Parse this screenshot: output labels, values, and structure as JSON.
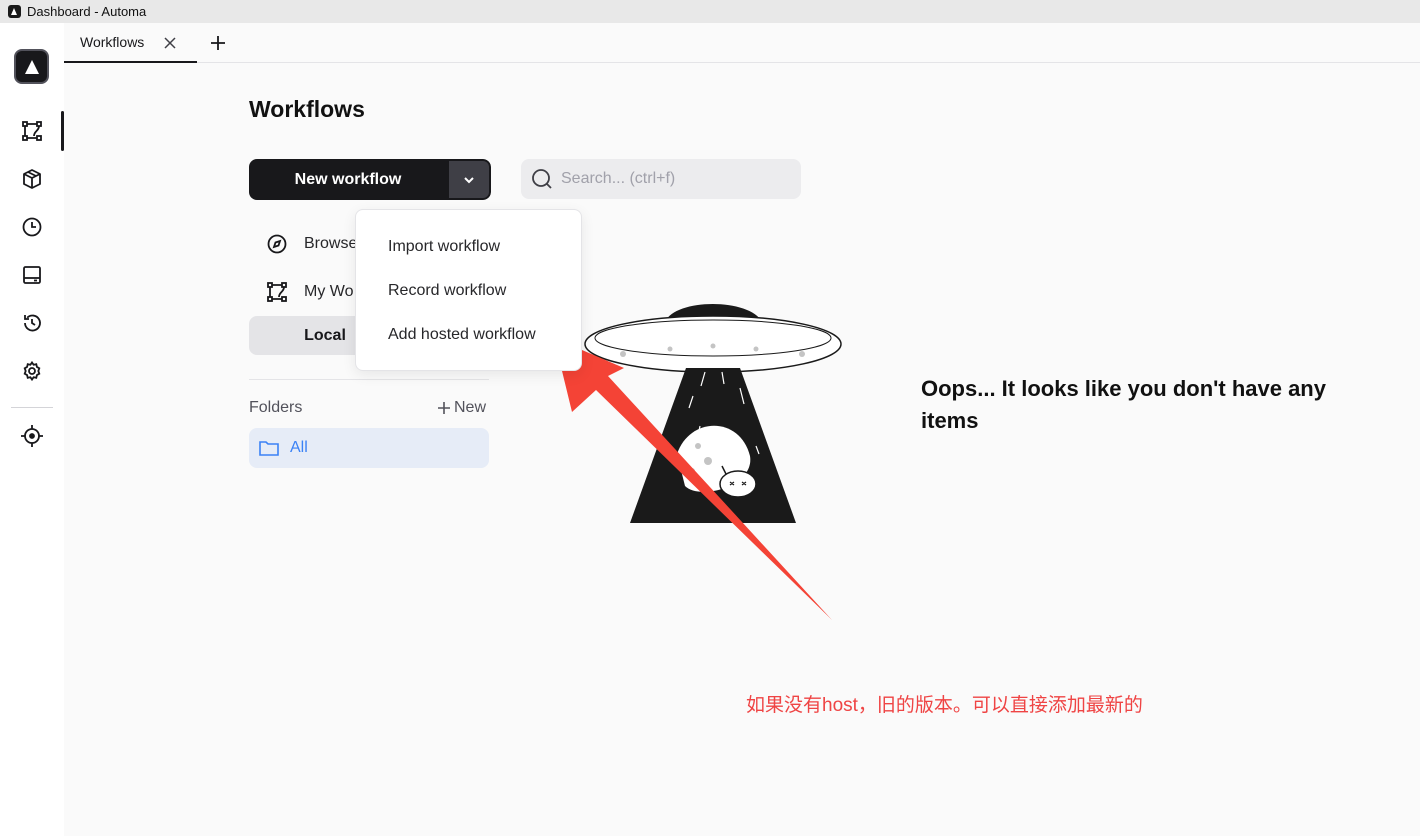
{
  "window": {
    "title": "Dashboard - Automa"
  },
  "tabs": [
    {
      "label": "Workflows"
    }
  ],
  "main": {
    "title": "Workflows",
    "new_workflow_label": "New workflow",
    "search": {
      "placeholder": "Search... (ctrl+f)"
    },
    "menu": {
      "browse_label": "Browse",
      "my_workflows_label": "My Wo",
      "local_label": "Local"
    },
    "folders": {
      "label": "Folders",
      "new_label": "New",
      "items": [
        {
          "label": "All"
        }
      ]
    }
  },
  "dropdown": {
    "items": [
      {
        "label": "Import workflow"
      },
      {
        "label": "Record workflow"
      },
      {
        "label": "Add hosted workflow"
      }
    ]
  },
  "empty_state": {
    "message": "Oops... It looks like you don't have any items"
  },
  "annotation": {
    "text": "如果没有host，旧的版本。可以直接添加最新的",
    "color": "#ef4444"
  },
  "sidebar": {
    "items": [
      {
        "icon": "workflow-icon"
      },
      {
        "icon": "package-icon"
      },
      {
        "icon": "clock-icon"
      },
      {
        "icon": "storage-icon"
      },
      {
        "icon": "history-icon"
      },
      {
        "icon": "settings-icon"
      },
      {
        "icon": "crosshair-icon"
      }
    ]
  }
}
